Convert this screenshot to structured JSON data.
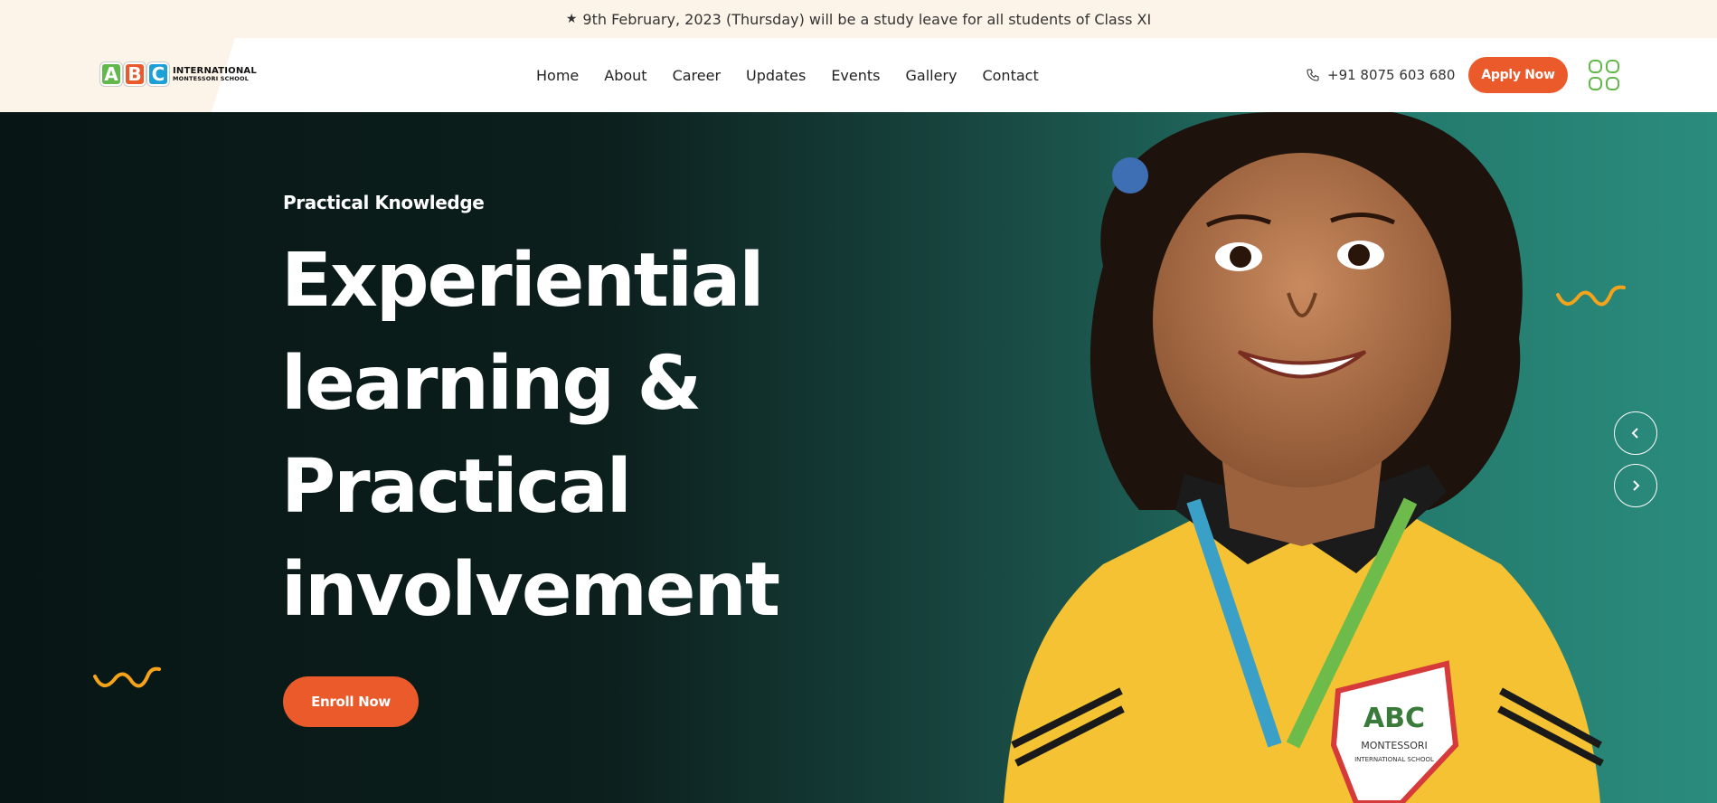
{
  "announcement": {
    "icon": "star-icon",
    "text": "9th February, 2023 (Thursday) will be a study leave for all students of Class XI"
  },
  "logo": {
    "letters": [
      "A",
      "B",
      "C"
    ],
    "line1": "INTERNATIONAL",
    "line2": "MONTESSORI SCHOOL"
  },
  "nav": {
    "items": [
      "Home",
      "About",
      "Career",
      "Updates",
      "Events",
      "Gallery",
      "Contact"
    ]
  },
  "header": {
    "phone": "+91 8075 603 680",
    "apply_label": "Apply Now"
  },
  "hero": {
    "subtitle": "Practical Knowledge",
    "headline": [
      "Experiential",
      "learning &",
      "Practical",
      "involvement"
    ],
    "enroll_label": "Enroll Now",
    "badge": {
      "letters": "ABC",
      "line1": "MONTESSORI",
      "line2": "INTERNATIONAL SCHOOL"
    }
  },
  "colors": {
    "accent": "#ea5a2b",
    "brand_green": "#62b84a",
    "brand_blue": "#1d9fd8",
    "announce_bg": "#fdf4e9",
    "squiggle": "#f4a31b"
  }
}
